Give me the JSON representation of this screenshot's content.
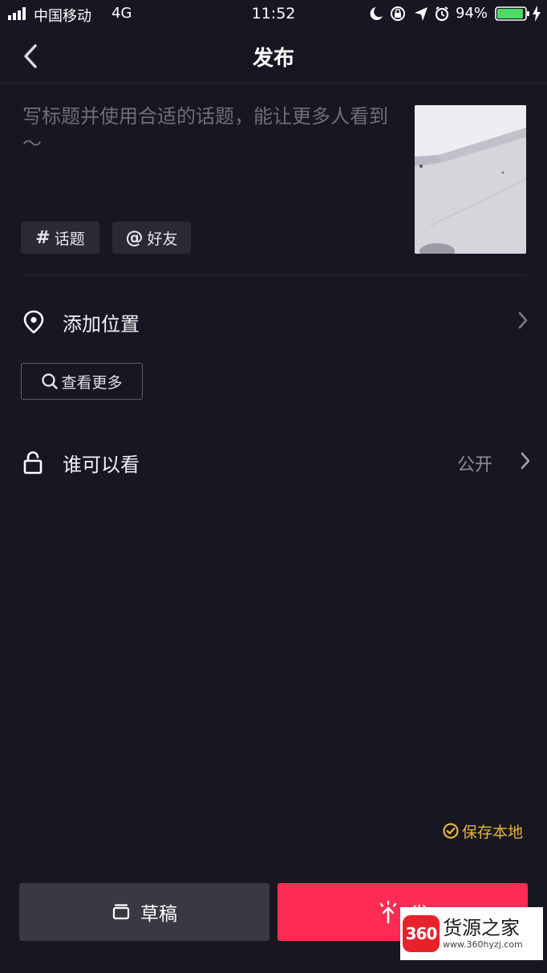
{
  "status_bar": {
    "carrier": "中国移动",
    "network": "4G",
    "time": "11:52",
    "battery": "94%",
    "battery_level": 0.94
  },
  "nav": {
    "title": "发布",
    "back_icon": "chevron-left-icon"
  },
  "caption": {
    "placeholder": "写标题并使用合适的话题，能让更多人看到～"
  },
  "chips": {
    "topic_glyph": "#",
    "topic_label": "话题",
    "friend_glyph": "@",
    "friend_label": "好友"
  },
  "location": {
    "label": "添加位置",
    "icon": "location-pin-icon"
  },
  "see_more": {
    "label": "查看更多",
    "icon": "search-icon"
  },
  "visibility": {
    "label": "谁可以看",
    "value": "公开",
    "icon": "unlock-icon"
  },
  "save_local": {
    "label": "保存本地",
    "checked": true,
    "color": "#e7b53a"
  },
  "buttons": {
    "draft_label": "草稿",
    "publish_label": "发",
    "publish_color": "#fe2c55"
  },
  "watermark": {
    "badge": "360",
    "name": "货源之家",
    "url": "www.360hyzj.com"
  },
  "colors": {
    "background": "#171724",
    "accent": "#fe2c55"
  }
}
